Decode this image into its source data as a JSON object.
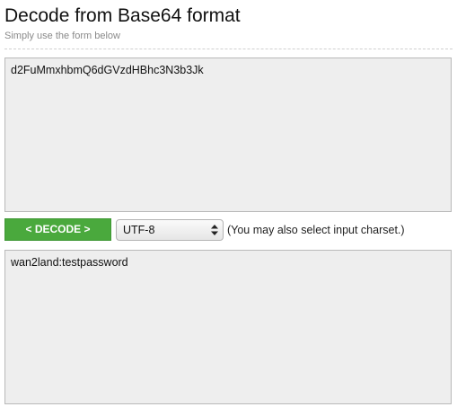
{
  "header": {
    "title": "Decode from Base64 format",
    "subtitle": "Simply use the form below"
  },
  "form": {
    "input_value": "d2FuMmxhbmQ6dGVzdHBhc3N3b3Jk",
    "decode_label": "< DECODE >",
    "charset": {
      "selected": "UTF-8",
      "note": "(You may also select input charset.)"
    },
    "output_value": "wan2land:testpassword"
  },
  "colors": {
    "decode_button": "#4aa93d",
    "textarea_bg": "#eeeeee"
  },
  "icons": {
    "select": "select-arrows-icon"
  }
}
